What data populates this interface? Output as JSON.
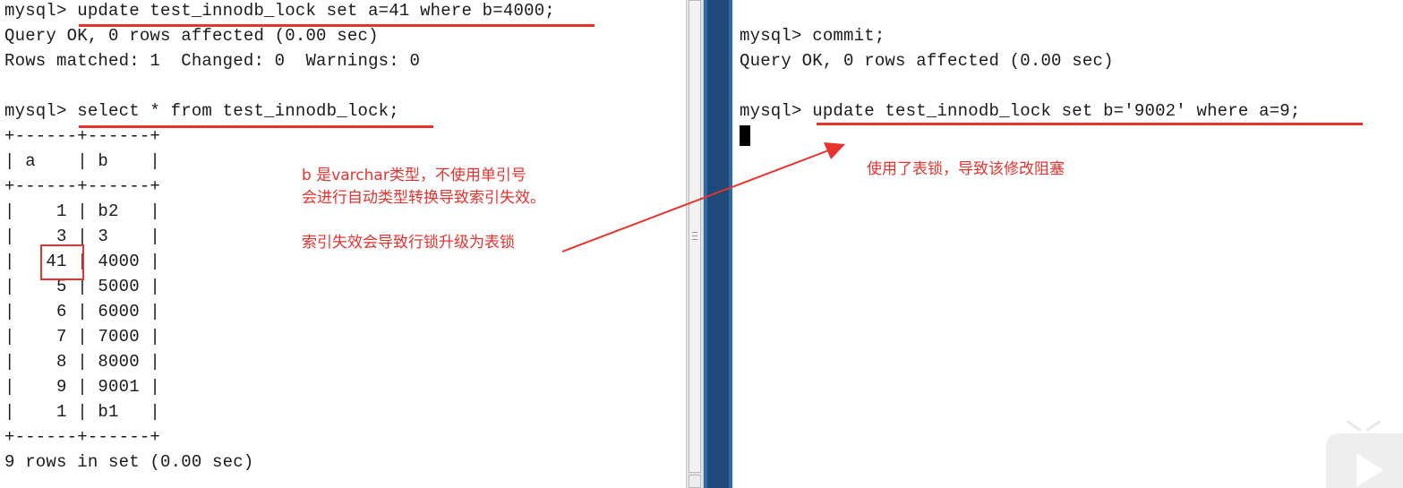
{
  "left_terminal": {
    "lines": [
      "mysql> update test_innodb_lock set a=41 where b=4000;",
      "Query OK, 0 rows affected (0.00 sec)",
      "Rows matched: 1  Changed: 0  Warnings: 0",
      "",
      "mysql> select * from test_innodb_lock;",
      "+------+------+",
      "| a    | b    |",
      "+------+------+",
      "|    1 | b2   |",
      "|    3 | 3    |",
      "|   41 | 4000 |",
      "|    5 | 5000 |",
      "|    6 | 6000 |",
      "|    7 | 7000 |",
      "|    8 | 8000 |",
      "|    9 | 9001 |",
      "|    1 | b1   |",
      "+------+------+",
      "9 rows in set (0.00 sec)"
    ]
  },
  "right_terminal": {
    "lines": [
      "",
      "mysql> commit;",
      "Query OK, 0 rows affected (0.00 sec)",
      "",
      "mysql> update test_innodb_lock set b='9002' where a=9;"
    ]
  },
  "annotations": {
    "note_varchar_line1": "b 是varchar类型，不使用单引号",
    "note_varchar_line2": "会进行自动类型转换导致索引失效。",
    "note_row_to_table": "索引失效会导致行锁升级为表锁",
    "note_blocked": "使用了表锁，导致该修改阻塞"
  },
  "colors": {
    "annotation_red": "#e8322e",
    "terminal_text": "#1a1a1a",
    "divider_blue": "#1e4a7a"
  },
  "icons": {
    "video_overlay": "play-icon",
    "terminal_cursor": "block-cursor"
  }
}
